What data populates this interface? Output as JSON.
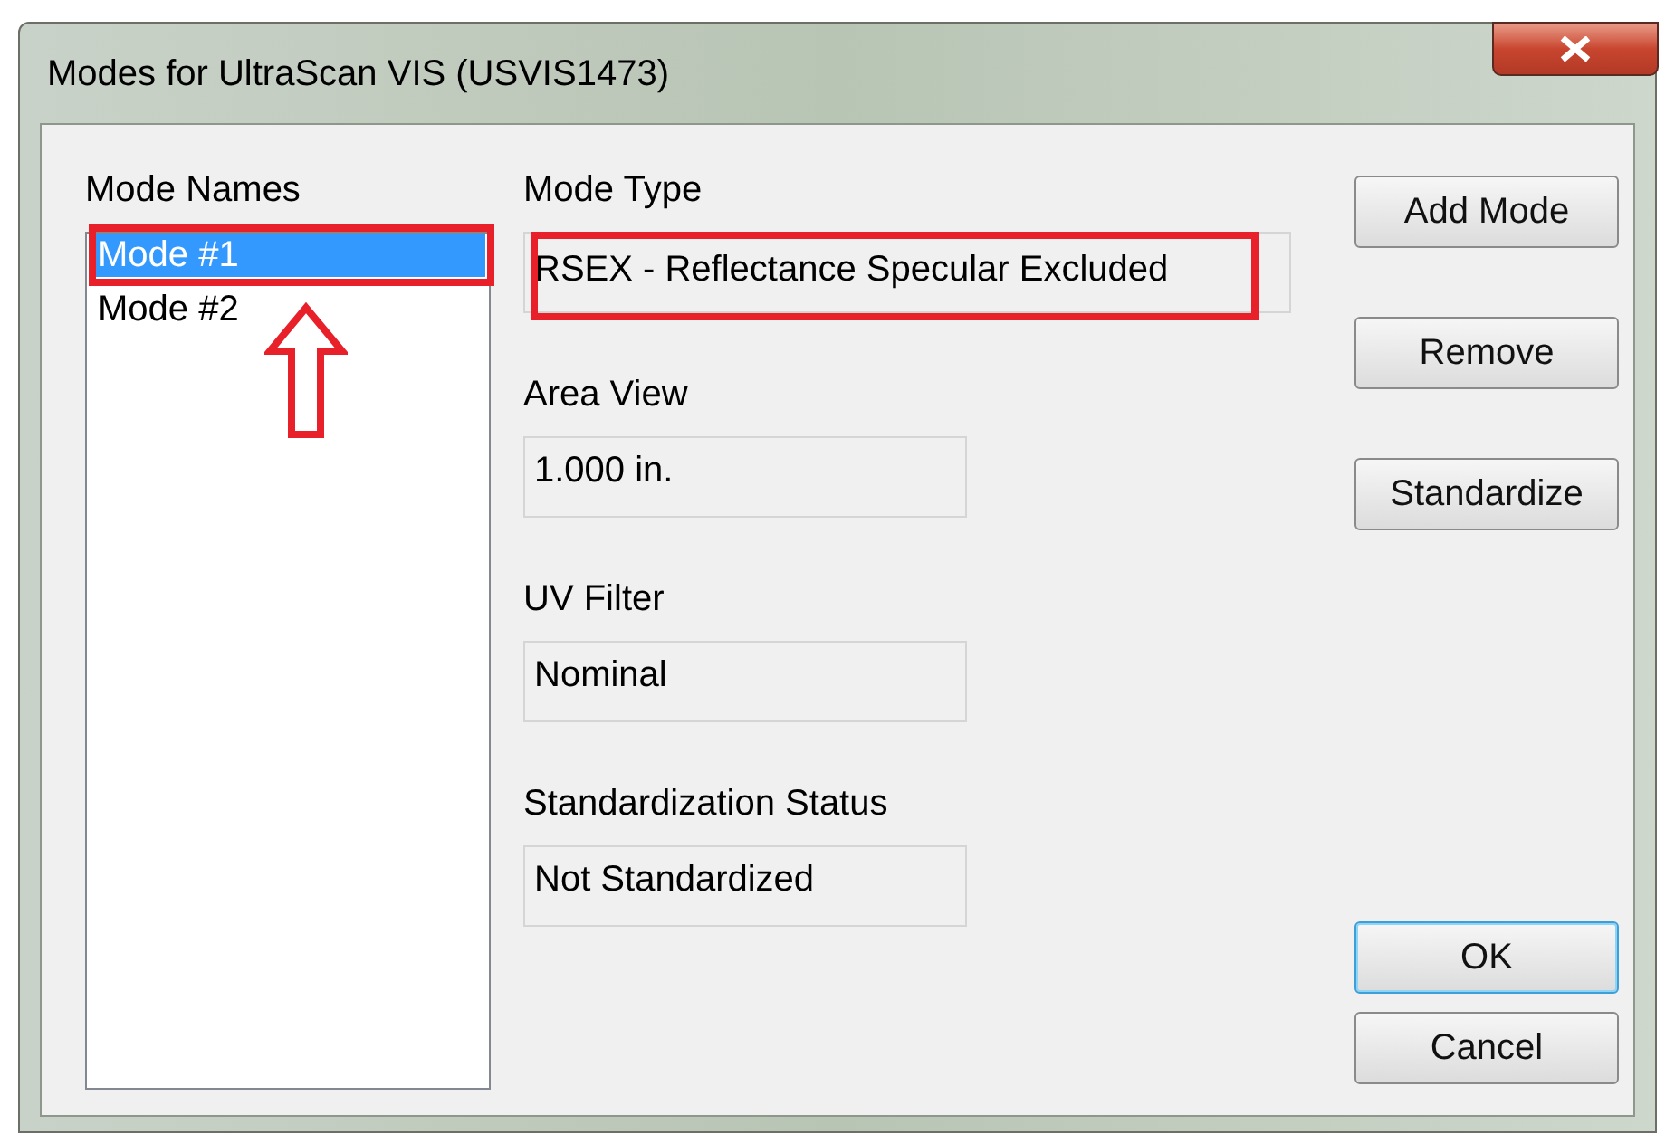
{
  "window": {
    "title": "Modes for UltraScan VIS (USVIS1473)"
  },
  "mode_list": {
    "label": "Mode Names",
    "items": [
      {
        "name": "Mode #1",
        "selected": true
      },
      {
        "name": "Mode #2",
        "selected": false
      }
    ]
  },
  "mode_type": {
    "label": "Mode Type",
    "value": "RSEX - Reflectance Specular Excluded"
  },
  "fields": [
    {
      "label": "Area View",
      "value": "1.000 in."
    },
    {
      "label": "UV Filter",
      "value": "Nominal"
    },
    {
      "label": "Standardization Status",
      "value": "Not Standardized"
    }
  ],
  "action_buttons": [
    {
      "label": "Add Mode"
    },
    {
      "label": "Remove"
    },
    {
      "label": "Standardize"
    }
  ],
  "dialog_buttons": [
    {
      "label": "OK",
      "default": true
    },
    {
      "label": "Cancel",
      "default": false
    }
  ]
}
